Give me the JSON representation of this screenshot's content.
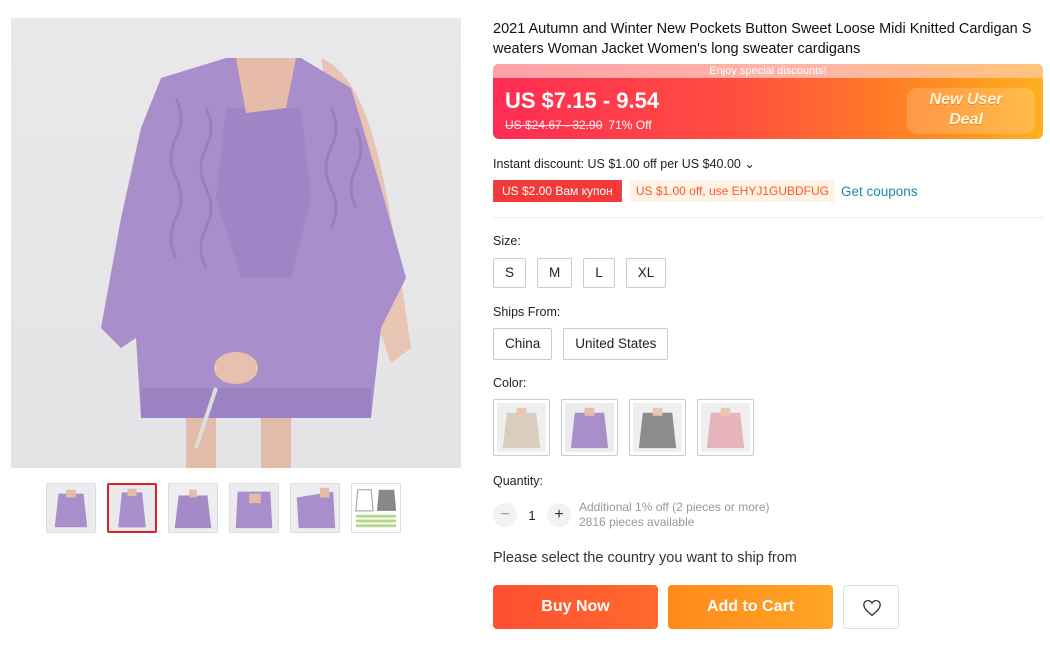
{
  "product": {
    "title": "2021 Autumn and Winter New Pockets Button Sweet Loose Midi Knitted Cardigan Sweaters Woman Jacket Women's long sweater cardigans"
  },
  "gallery": {
    "main_image": "purple-cardigan-photo",
    "thumbnails": [
      {
        "id": "thumb-1",
        "active": false
      },
      {
        "id": "thumb-2",
        "active": true
      },
      {
        "id": "thumb-3",
        "active": false
      },
      {
        "id": "thumb-4",
        "active": false
      },
      {
        "id": "thumb-5",
        "active": false
      },
      {
        "id": "thumb-6-size-chart",
        "active": false
      }
    ]
  },
  "price_banner": {
    "strip_text": "Enjoy special discounts!",
    "price": "US $7.15 - 9.54",
    "old_price": "US $24.67 - 32.90",
    "discount": "71% Off",
    "deal_label": "New User Deal"
  },
  "instant_discount": "Instant discount: US $1.00 off per US $40.00 ⌄",
  "coupons": {
    "red": "US $2.00 Вам купон",
    "orange": "US $1.00 off, use EHYJ1GUBDFUG",
    "link": "Get coupons"
  },
  "size": {
    "label": "Size:",
    "options": [
      "S",
      "M",
      "L",
      "XL"
    ]
  },
  "ships_from": {
    "label": "Ships From:",
    "options": [
      "China",
      "United States"
    ]
  },
  "color": {
    "label": "Color:",
    "swatches": [
      "beige",
      "purple",
      "gray",
      "pink"
    ]
  },
  "quantity": {
    "label": "Quantity:",
    "minus": "−",
    "value": "1",
    "plus": "+",
    "note": "Additional 1% off (2 pieces or more)",
    "available": "2816 pieces available"
  },
  "ship_note": "Please select the country you want to ship from",
  "actions": {
    "buy_now": "Buy Now",
    "add_to_cart": "Add to Cart"
  },
  "colors": {
    "price_red": "#ff2b55",
    "orange": "#ff8a1c",
    "link": "#1a8ba8"
  }
}
